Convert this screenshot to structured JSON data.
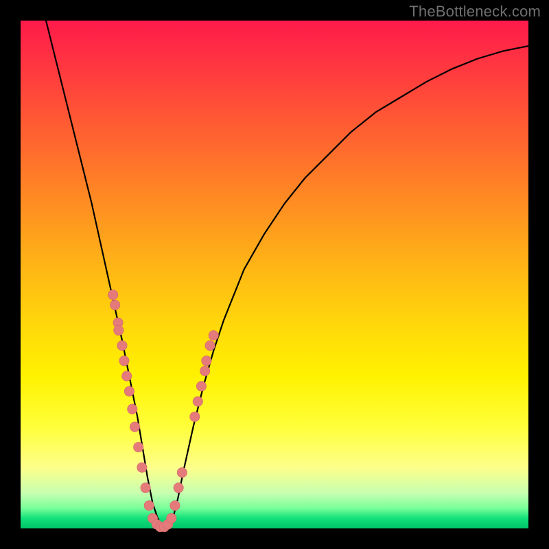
{
  "watermark": "TheBottleneck.com",
  "chart_data": {
    "type": "line",
    "title": "",
    "xlabel": "",
    "ylabel": "",
    "xlim": [
      0,
      100
    ],
    "ylim": [
      0,
      100
    ],
    "x": [
      0,
      2,
      4,
      6,
      8,
      10,
      12,
      14,
      16,
      18,
      20,
      21,
      22,
      23,
      24,
      25,
      26,
      27,
      28,
      29,
      30,
      31,
      32,
      34,
      36,
      38,
      40,
      44,
      48,
      52,
      56,
      60,
      65,
      70,
      75,
      80,
      85,
      90,
      95,
      100
    ],
    "values": [
      120,
      112,
      104,
      96,
      88,
      80,
      72,
      64,
      55,
      46,
      37,
      32,
      27,
      22,
      16,
      10,
      5,
      2,
      0.3,
      0.3,
      2,
      6,
      11,
      20,
      28,
      35,
      41,
      51,
      58,
      64,
      69,
      73,
      78,
      82,
      85,
      88,
      90.5,
      92.5,
      94,
      95
    ],
    "points_overlay": [
      {
        "x": 18.2,
        "y": 46
      },
      {
        "x": 18.6,
        "y": 44
      },
      {
        "x": 19.2,
        "y": 40.5
      },
      {
        "x": 19.3,
        "y": 39
      },
      {
        "x": 20.0,
        "y": 36
      },
      {
        "x": 20.4,
        "y": 33
      },
      {
        "x": 20.9,
        "y": 30
      },
      {
        "x": 21.4,
        "y": 27
      },
      {
        "x": 22.0,
        "y": 23.5
      },
      {
        "x": 22.5,
        "y": 20
      },
      {
        "x": 23.2,
        "y": 16
      },
      {
        "x": 23.9,
        "y": 12
      },
      {
        "x": 24.6,
        "y": 8
      },
      {
        "x": 25.3,
        "y": 4.5
      },
      {
        "x": 26.0,
        "y": 2
      },
      {
        "x": 26.8,
        "y": 0.8
      },
      {
        "x": 27.5,
        "y": 0.3
      },
      {
        "x": 28.3,
        "y": 0.3
      },
      {
        "x": 29.0,
        "y": 0.8
      },
      {
        "x": 29.7,
        "y": 2
      },
      {
        "x": 30.4,
        "y": 4.5
      },
      {
        "x": 31.1,
        "y": 8
      },
      {
        "x": 31.8,
        "y": 11
      },
      {
        "x": 34.3,
        "y": 22
      },
      {
        "x": 34.9,
        "y": 25
      },
      {
        "x": 35.6,
        "y": 28
      },
      {
        "x": 36.3,
        "y": 31
      },
      {
        "x": 36.6,
        "y": 33
      },
      {
        "x": 37.3,
        "y": 36
      },
      {
        "x": 38.0,
        "y": 38
      }
    ]
  }
}
